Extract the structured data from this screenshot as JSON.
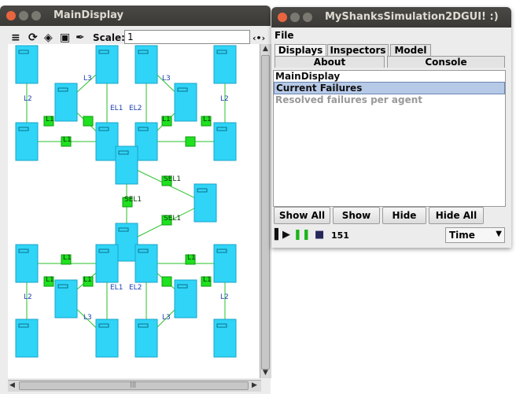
{
  "main_display": {
    "title": "MainDisplay",
    "scale_label": "Scale:",
    "scale_value": "1",
    "pan_icon": "‹•›",
    "toolbar_icons": [
      "list-icon",
      "refresh-icon",
      "record-icon",
      "camera-icon",
      "wrench-icon"
    ],
    "scroll_hmark": "|||"
  },
  "network": {
    "node_color": "#2fd4f7",
    "link_box_color": "#1fe11f",
    "labels": {
      "l1": "L1",
      "l2": "L2",
      "l3": "L3",
      "el1": "EL1",
      "el2": "EL2",
      "sel1": "SEL1"
    }
  },
  "console_window": {
    "title": "MyShanksSimulation2DGUI! :)",
    "menu_file": "File",
    "tabs": [
      "Displays",
      "Inspectors",
      "Model"
    ],
    "tabs_row2": [
      "About",
      "Console"
    ],
    "selected_tab": "Displays",
    "list_items": [
      "MainDisplay",
      "Current Failures",
      "Resolved failures per agent"
    ],
    "selected_item": "Current Failures",
    "buttons": [
      "Show All",
      "Show",
      "Hide",
      "Hide All"
    ],
    "step_count": "151",
    "time_option": "Time"
  }
}
